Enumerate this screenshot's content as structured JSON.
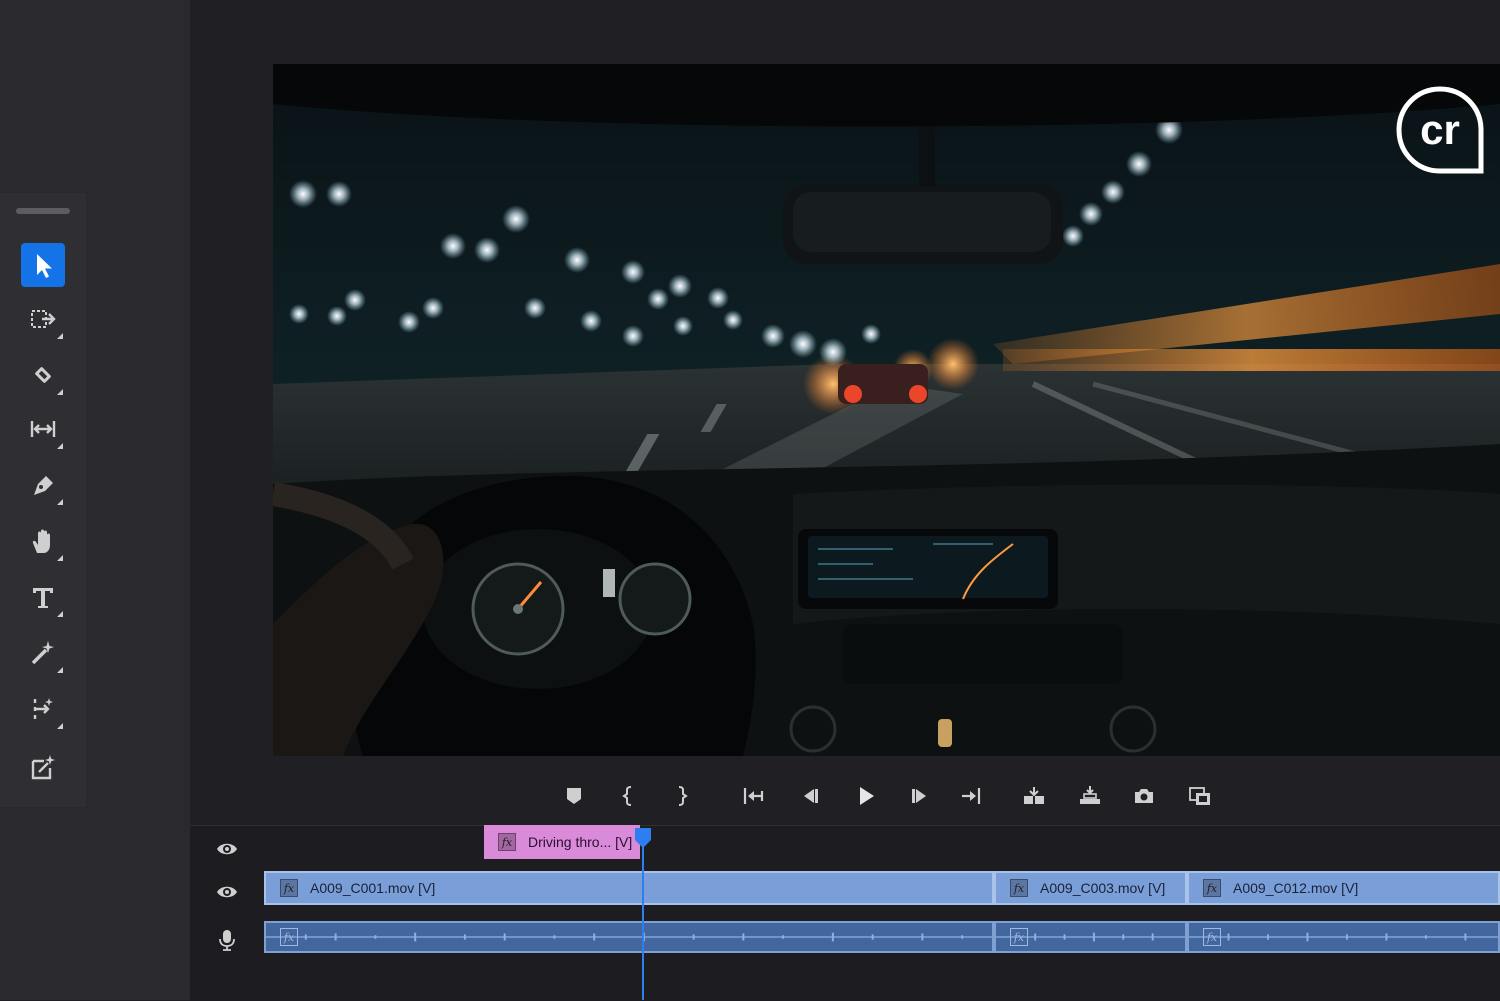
{
  "colors": {
    "accent": "#1473e6",
    "video_clip": "#7a9ed8",
    "audio_clip": "#41679e",
    "nested_clip": "#d98ad8",
    "panel": "#2e2e33",
    "background": "#202024"
  },
  "tools": [
    {
      "name": "selection-tool-icon",
      "active": true
    },
    {
      "name": "track-select-forward-tool-icon"
    },
    {
      "name": "razor-tool-icon"
    },
    {
      "name": "ripple-edit-tool-icon"
    },
    {
      "name": "pen-tool-icon"
    },
    {
      "name": "hand-tool-icon"
    },
    {
      "name": "type-tool-icon"
    },
    {
      "name": "magic-wand-tool-icon"
    },
    {
      "name": "generative-extend-tool-icon"
    },
    {
      "name": "export-frame-tool-icon"
    }
  ],
  "monitor": {
    "watermark_text": "cr"
  },
  "transport": [
    "add-marker-icon",
    "mark-in-icon",
    "mark-out-icon",
    "go-to-in-icon",
    "step-back-icon",
    "play-icon",
    "step-forward-icon",
    "go-to-out-icon",
    "insert-icon",
    "overwrite-icon",
    "export-frame-icon",
    "multi-camera-icon"
  ],
  "timeline": {
    "v2_clip": {
      "label": "Driving thro... [V]"
    },
    "v1_clips": [
      {
        "label": "A009_C001.mov [V]"
      },
      {
        "label": "A009_C003.mov [V]"
      },
      {
        "label": "A009_C012.mov [V]"
      }
    ],
    "fx_label": "fx",
    "track_controls": [
      "eye-icon",
      "eye-icon",
      "microphone-icon"
    ]
  }
}
